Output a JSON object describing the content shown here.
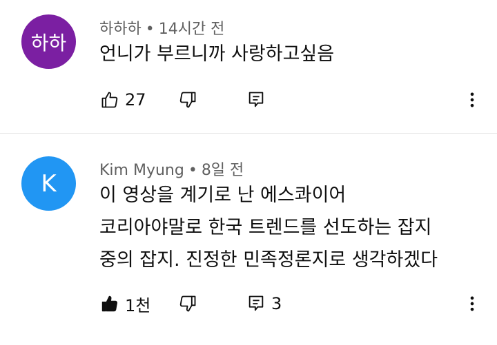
{
  "comments": [
    {
      "avatar_text": "하하",
      "avatar_color": "#7b1fa2",
      "author": "하하하",
      "separator": "•",
      "time": "14시간 전",
      "lines": [
        "언니가 부르니까 사랑하고싶음"
      ],
      "likes": "27",
      "replies": "",
      "liked": false,
      "like_icon": "thumbs-up-outline-icon",
      "dislike_icon": "thumbs-down-outline-icon",
      "reply_icon": "comment-reply-icon",
      "more_icon": "more-vertical-icon"
    },
    {
      "avatar_text": "K",
      "avatar_color": "#2196f3",
      "author": "Kim Myung",
      "separator": "•",
      "time": "8일 전",
      "lines": [
        "이 영상을 계기로 난 에스콰이어",
        "코리아야말로 한국 트렌드를 선도하는 잡지",
        "중의 잡지. 진정한 민족정론지로 생각하겠다"
      ],
      "likes": "1천",
      "replies": "3",
      "liked": true,
      "like_icon": "thumbs-up-filled-icon",
      "dislike_icon": "thumbs-down-outline-icon",
      "reply_icon": "comment-reply-icon",
      "more_icon": "more-vertical-icon"
    }
  ]
}
